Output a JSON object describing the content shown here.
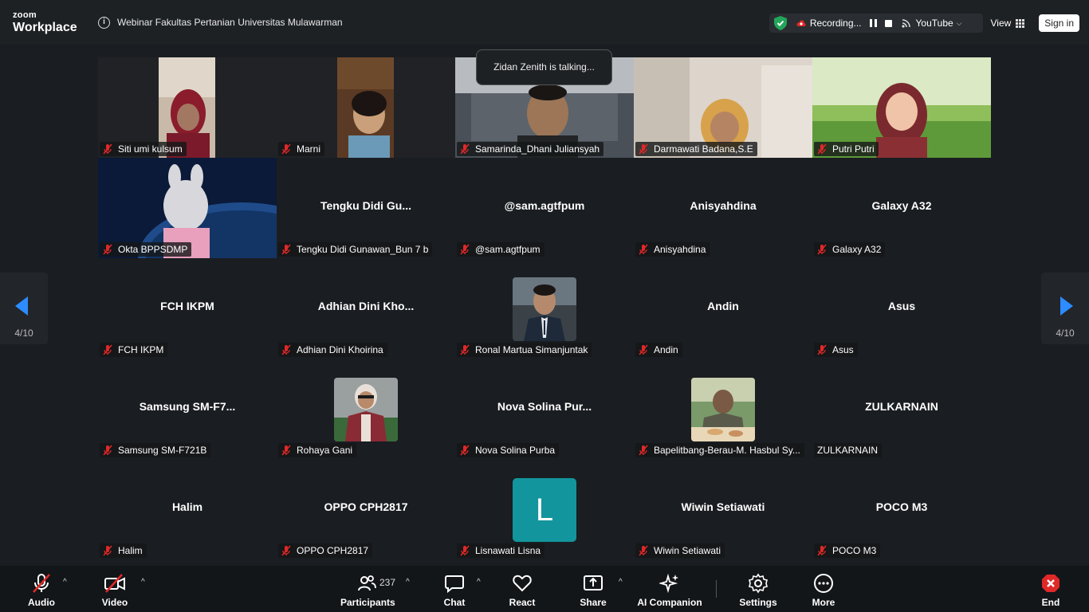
{
  "app": {
    "logo_top": "zoom",
    "logo_bottom": "Workplace"
  },
  "meeting": {
    "title": "Webinar Fakultas Pertanian Universitas Mulawarman"
  },
  "header": {
    "recording_label": "Recording...",
    "stream_label": "YouTube",
    "view_label": "View",
    "signin_label": "Sign in"
  },
  "talking_banner": "Zidan Zenith is talking...",
  "pager": {
    "left": "4/10",
    "right": "4/10"
  },
  "tiles": [
    {
      "label": "Siti umi kulsum",
      "center": ""
    },
    {
      "label": "Marni",
      "center": ""
    },
    {
      "label": "Samarinda_Dhani Juliansyah",
      "center": ""
    },
    {
      "label": "Darmawati Badana,S.E",
      "center": ""
    },
    {
      "label": "Putri Putri",
      "center": ""
    },
    {
      "label": "Okta BPPSDMP",
      "center": ""
    },
    {
      "label": "Tengku Didi Gunawan_Bun 7 b",
      "center": "Tengku  Didi  Gu..."
    },
    {
      "label": "@sam.agtfpum",
      "center": "@sam.agtfpum"
    },
    {
      "label": "Anisyahdina",
      "center": "Anisyahdina"
    },
    {
      "label": "Galaxy A32",
      "center": "Galaxy A32"
    },
    {
      "label": "FCH IKPM",
      "center": "FCH IKPM"
    },
    {
      "label": "Adhian Dini Khoirina",
      "center": "Adhian  Dini  Kho..."
    },
    {
      "label": "Ronal Martua Simanjuntak",
      "center": ""
    },
    {
      "label": "Andin",
      "center": "Andin"
    },
    {
      "label": "Asus",
      "center": "Asus"
    },
    {
      "label": "Samsung SM-F721B",
      "center": "Samsung  SM-F7..."
    },
    {
      "label": "Rohaya Gani",
      "center": ""
    },
    {
      "label": "Nova Solina Purba",
      "center": "Nova  Solina  Pur..."
    },
    {
      "label": "Bapelitbang-Berau-M. Hasbul Sy...",
      "center": ""
    },
    {
      "label": "ZULKARNAIN",
      "center": "ZULKARNAIN"
    },
    {
      "label": "Halim",
      "center": "Halim"
    },
    {
      "label": "OPPO CPH2817",
      "center": "OPPO CPH2817"
    },
    {
      "label": "Lisnawati Lisna",
      "center": "",
      "avatar_letter": "L"
    },
    {
      "label": "Wiwin Setiawati",
      "center": "Wiwin Setiawati"
    },
    {
      "label": "POCO M3",
      "center": "POCO M3"
    }
  ],
  "toolbar": {
    "audio": "Audio",
    "video": "Video",
    "participants": "Participants",
    "participants_count": "237",
    "chat": "Chat",
    "react": "React",
    "share": "Share",
    "ai": "AI Companion",
    "settings": "Settings",
    "more": "More",
    "end": "End"
  },
  "colors": {
    "accent": "#2d8cff",
    "mute_red": "#e02828",
    "avatar_teal": "#13959d"
  }
}
